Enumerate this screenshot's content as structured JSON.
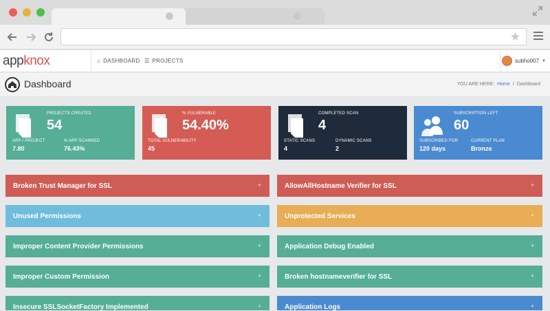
{
  "header": {
    "nav": [
      {
        "label": "DASHBOARD"
      },
      {
        "label": "PROJECTS"
      }
    ],
    "user": "subho007"
  },
  "page": {
    "title": "Dashboard",
    "breadcrumb": {
      "prefix": "YOU ARE HERE:",
      "home": "Home",
      "separator": "/",
      "current": "Dashboard"
    }
  },
  "cards": [
    {
      "title": "PROJECTS CREATED",
      "value": "54",
      "sub1_label": "APP / PROJECT",
      "sub1_value": "7.80",
      "sub2_label": "% APP SCANNED",
      "sub2_value": "76.43%",
      "color": "#55ae95"
    },
    {
      "title": "% VULNERABLE",
      "value": "54.40%",
      "sub1_label": "TOTAL VULNERABILITY",
      "sub1_value": "45",
      "color": "#d55c54"
    },
    {
      "title": "COMPLETED SCAN",
      "value": "4",
      "sub1_label": "STATIC SCANS",
      "sub1_value": "4",
      "sub2_label": "DYNAMIC SCANS",
      "sub2_value": "2",
      "color": "#1f2a3a"
    },
    {
      "title": "SUBSCRIPTION LEFT",
      "value": "60",
      "sub1_label": "SUBSCRIBED FOR",
      "sub1_value": "120 days",
      "sub2_label": "CURRENT PLAN",
      "sub2_value": "Bronze",
      "color": "#4a8ad0"
    }
  ],
  "issues_left": [
    {
      "label": "Broken Trust Manager for SSL",
      "color": "#d05d55"
    },
    {
      "label": "Unused Permissions",
      "color": "#70bcdc"
    },
    {
      "label": "Improper Content Provider Permissions",
      "color": "#55ae95"
    },
    {
      "label": "Improper Custom Permission",
      "color": "#55ae95"
    },
    {
      "label": "Insecure SSLSocketFactory Implemented",
      "color": "#55ae95"
    }
  ],
  "issues_right": [
    {
      "label": "AllowAllHostname Verifier for SSL",
      "color": "#d05d55"
    },
    {
      "label": "Unprotected Services",
      "color": "#e8ad55"
    },
    {
      "label": "Application Debug Enabled",
      "color": "#55ae95"
    },
    {
      "label": "Broken hostnameverifier for SSL",
      "color": "#55ae95"
    },
    {
      "label": "Application Logs",
      "color": "#4a8ad0"
    }
  ],
  "plus_symbol": "+"
}
